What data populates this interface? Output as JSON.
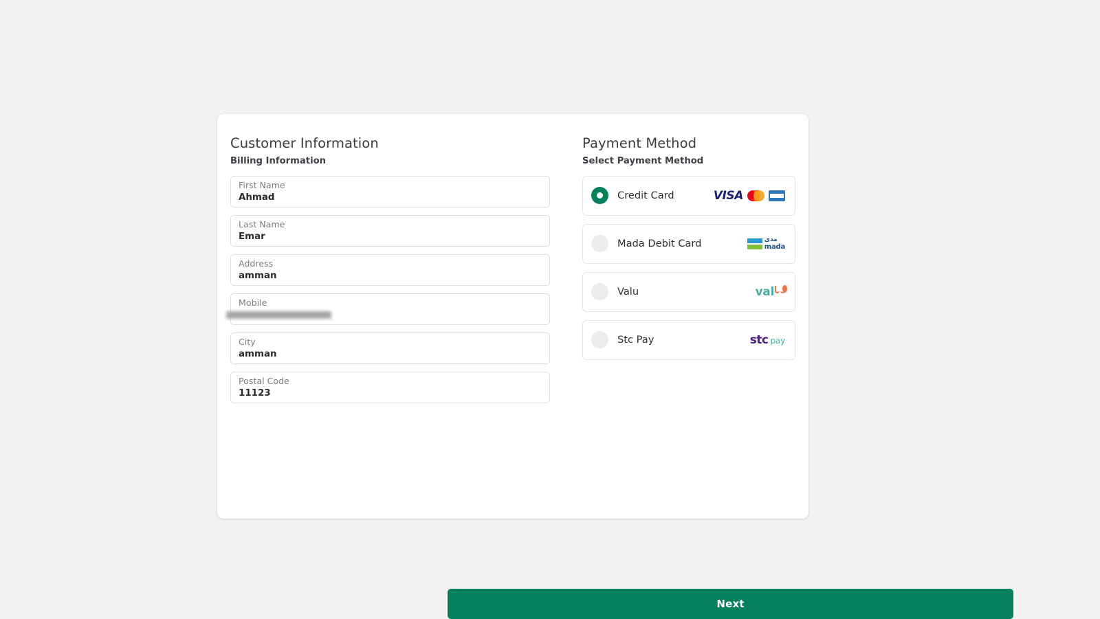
{
  "theme": {
    "page_background": "#f2f2f2",
    "card_background": "#ffffff",
    "accent_green": "#04805a",
    "field_border": "#dedede",
    "radio_unselected": "#ececec"
  },
  "customer": {
    "title": "Customer Information",
    "subtitle": "Billing Information",
    "fields": [
      {
        "label": "First Name",
        "value": "Ahmad",
        "redacted": false
      },
      {
        "label": "Last Name",
        "value": "Emar",
        "redacted": false
      },
      {
        "label": "Address",
        "value": "amman",
        "redacted": false
      },
      {
        "label": "Mobile",
        "value": "",
        "redacted": true
      },
      {
        "label": "City",
        "value": "amman",
        "redacted": false
      },
      {
        "label": "Postal Code",
        "value": "11123",
        "redacted": false
      }
    ]
  },
  "payment": {
    "title": "Payment Method",
    "subtitle": "Select Payment Method",
    "options": [
      {
        "label": "Credit Card",
        "selected": true,
        "logos": [
          "visa-logo",
          "mastercard-logo",
          "amex-logo"
        ]
      },
      {
        "label": "Mada Debit Card",
        "selected": false,
        "logos": [
          "mada-logo"
        ]
      },
      {
        "label": "Valu",
        "selected": false,
        "logos": [
          "valu-logo"
        ]
      },
      {
        "label": "Stc Pay",
        "selected": false,
        "logos": [
          "stcpay-logo"
        ]
      }
    ],
    "logo_text": {
      "visa": "VISA",
      "mada_arabic": "مدى",
      "mada_latin": "mada",
      "valu": "val",
      "stc": "stc",
      "stc_pay": "pay"
    }
  },
  "actions": {
    "next_label": "Next"
  }
}
